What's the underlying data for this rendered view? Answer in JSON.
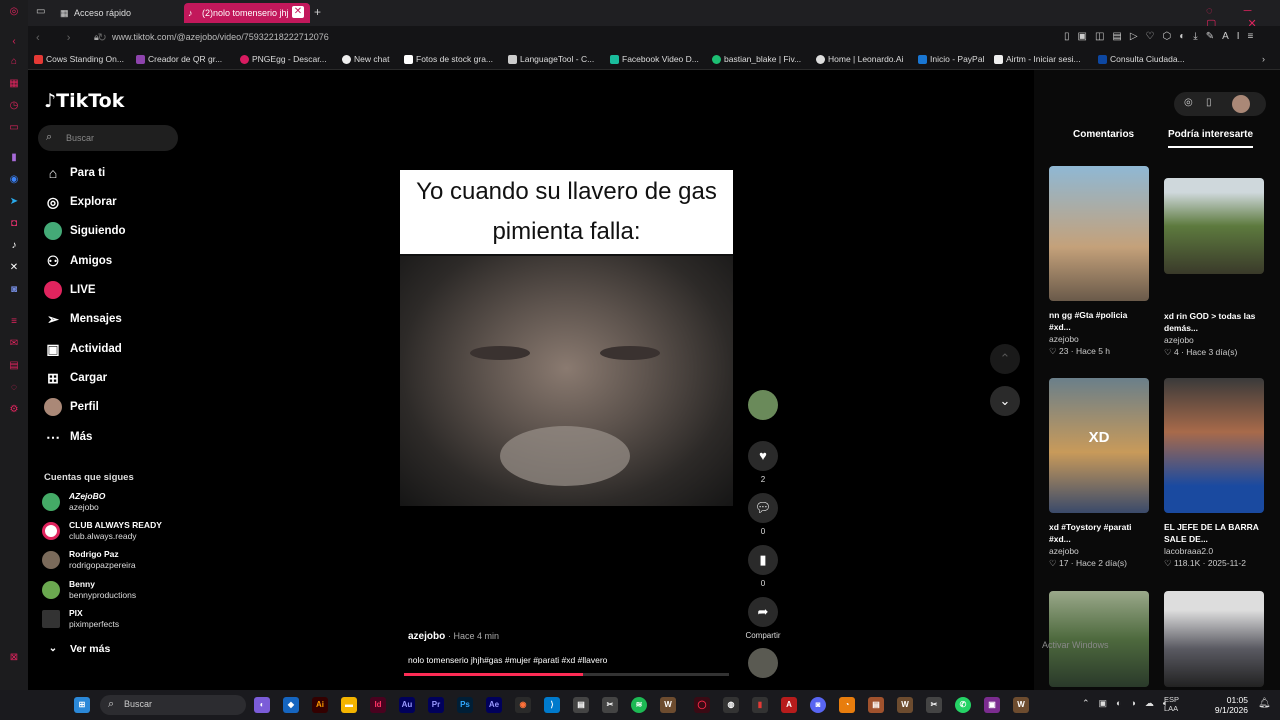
{
  "browser": {
    "tabs": [
      {
        "label": "Acceso rápido"
      },
      {
        "label": "(2)nolo tomenserio jhj"
      }
    ],
    "url": "www.tiktok.com/@azejobo/video/7593221822271207​6",
    "bookmarks": [
      "Cows Standing On...",
      "Creador de QR gr...",
      "PNGEgg - Descar...",
      "New chat",
      "Fotos de stock gra...",
      "LanguageTool - C...",
      "Facebook Video D...",
      "bastian_blake | Fiv...",
      "Home | Leonardo.Ai",
      "Inicio - PayPal",
      "Airtm - Iniciar sesi...",
      "Consulta Ciudada..."
    ]
  },
  "tiktok": {
    "logo": "TikTok",
    "search_placeholder": "Buscar",
    "nav": [
      {
        "label": "Para ti",
        "icon": "home-icon"
      },
      {
        "label": "Explorar",
        "icon": "compass-icon"
      },
      {
        "label": "Siguiendo",
        "icon": "following-icon"
      },
      {
        "label": "Amigos",
        "icon": "friends-icon"
      },
      {
        "label": "LIVE",
        "icon": "live-icon"
      },
      {
        "label": "Mensajes",
        "icon": "messages-icon"
      },
      {
        "label": "Actividad",
        "icon": "activity-icon"
      },
      {
        "label": "Cargar",
        "icon": "upload-icon"
      },
      {
        "label": "Perfil",
        "icon": "profile-icon"
      },
      {
        "label": "Más",
        "icon": "more-icon"
      }
    ],
    "following_title": "Cuentas que sigues",
    "following": [
      {
        "name": "AZejoBO",
        "handle": "azejobo"
      },
      {
        "name": "CLUB ALWAYS READY",
        "handle": "club.always.ready"
      },
      {
        "name": "Rodrigo Paz",
        "handle": "rodrigopazpereira"
      },
      {
        "name": "Benny",
        "handle": "bennyproductions"
      },
      {
        "name": "PIX",
        "handle": "piximperfects"
      }
    ],
    "see_more": "Ver más"
  },
  "video": {
    "caption_text": "Yo cuando su llavero de gas pimienta falla:",
    "author": "azejobo",
    "time": "· Hace 4 min",
    "description": "nolo tomenserio jhjh#gas #mujer #parati #xd #llavero",
    "progress": 0.55,
    "likes": "2",
    "comments": "0",
    "saves": "0",
    "share_label": "Compartir"
  },
  "right_panel": {
    "tabs": [
      "Comentarios",
      "Podría interesarte"
    ],
    "cards": [
      {
        "title": "nn gg #Gta #policia #xd...",
        "user": "azejobo",
        "meta": "♡ 23 · Hace 5 h",
        "color": "#5b7d8f"
      },
      {
        "title": "xd rin GOD > todas las demás...",
        "user": "azejobo",
        "meta": "♡ 4 · Hace 3 día(s)",
        "color": "#6d7f54"
      },
      {
        "title": "xd #Toystory #parati #xd...",
        "user": "azejobo",
        "meta": "♡ 17 · Hace 2 día(s)",
        "color": "#7a6a4a",
        "overlay": "XD"
      },
      {
        "title": "EL JEFE DE LA BARRA SALE DE...",
        "user": "lacobraaa2.0",
        "meta": "♡ 118.1K · 2025-11-2",
        "color": "#8a5a4a"
      },
      {
        "title": "",
        "user": "",
        "meta": "",
        "color": "#4e6a3e"
      },
      {
        "title": "",
        "user": "",
        "meta": "",
        "color": "#5a5a62"
      }
    ],
    "watermark": "Activar Windows"
  },
  "taskbar": {
    "search": "Buscar",
    "lang": "ESP\nLAA",
    "time": "01:05",
    "date": "9/1/2026"
  }
}
